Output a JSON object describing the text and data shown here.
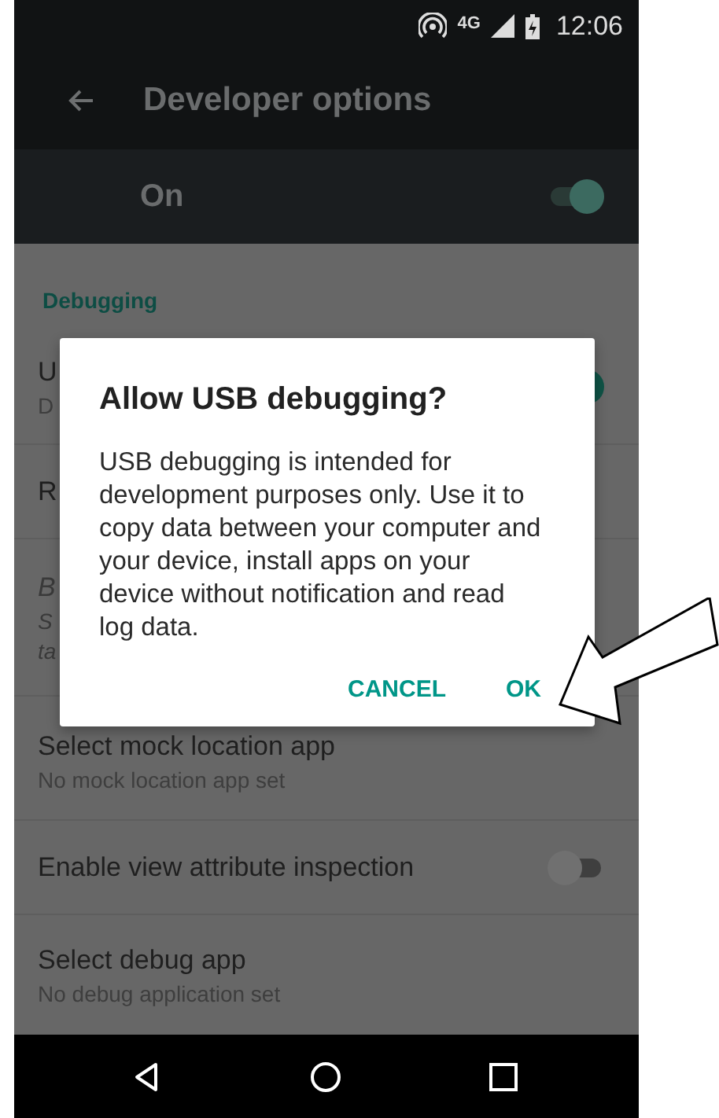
{
  "status_bar": {
    "network": "4G",
    "time": "12:06"
  },
  "toolbar": {
    "title": "Developer options"
  },
  "master_switch": {
    "label": "On",
    "on": true
  },
  "section": {
    "title": "Debugging"
  },
  "rows": [
    {
      "kind": "toggle",
      "title": "U",
      "subtitles": [
        "D"
      ],
      "on": true,
      "disabled": false
    },
    {
      "kind": "text",
      "title": "R",
      "subtitles": [],
      "disabled": false
    },
    {
      "kind": "text",
      "title": "B",
      "subtitles": [
        "S",
        "ta"
      ],
      "disabled": true
    },
    {
      "kind": "text",
      "title": "Select mock location app",
      "subtitles": [
        "No mock location app set"
      ],
      "disabled": false
    },
    {
      "kind": "toggle",
      "title": "Enable view attribute inspection",
      "subtitles": [],
      "on": false,
      "disabled": false
    },
    {
      "kind": "text",
      "title": "Select debug app",
      "subtitles": [
        "No debug application set"
      ],
      "disabled": false
    }
  ],
  "dialog": {
    "title": "Allow USB debugging?",
    "message": "USB debugging is intended for development purposes only. Use it to copy data between your computer and your device, install apps on your device without notification and read log data.",
    "buttons": [
      "CANCEL",
      "OK"
    ]
  }
}
